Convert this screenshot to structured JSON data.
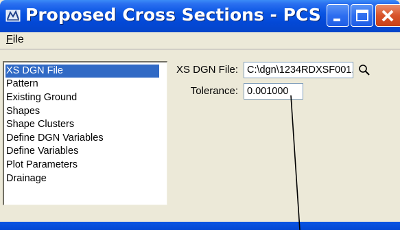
{
  "window": {
    "title": "Proposed Cross Sections - PCS"
  },
  "menu": {
    "file_label_underlined": "F",
    "file_label_rest": "ile"
  },
  "sidebar": {
    "items": [
      {
        "label": "XS DGN File",
        "selected": true
      },
      {
        "label": "Pattern",
        "selected": false
      },
      {
        "label": "Existing Ground",
        "selected": false
      },
      {
        "label": "Shapes",
        "selected": false
      },
      {
        "label": "Shape Clusters",
        "selected": false
      },
      {
        "label": "Define DGN Variables",
        "selected": false
      },
      {
        "label": "Define Variables",
        "selected": false
      },
      {
        "label": "Plot Parameters",
        "selected": false
      },
      {
        "label": "Drainage",
        "selected": false
      }
    ]
  },
  "form": {
    "xs_dgn_file_label": "XS DGN File:",
    "xs_dgn_file_value": "C:\\dgn\\1234RDXSF001.",
    "tolerance_label": "Tolerance:",
    "tolerance_value": "0.001000"
  },
  "colors": {
    "titlebar": "#0348d6",
    "selection": "#316ac5",
    "window_bg": "#ece9d8",
    "close_button": "#d8532a"
  },
  "icons": {
    "app": "pcs-app-icon",
    "minimize": "minimize-icon",
    "maximize": "maximize-icon",
    "close": "close-icon",
    "browse": "magnifier-icon"
  }
}
